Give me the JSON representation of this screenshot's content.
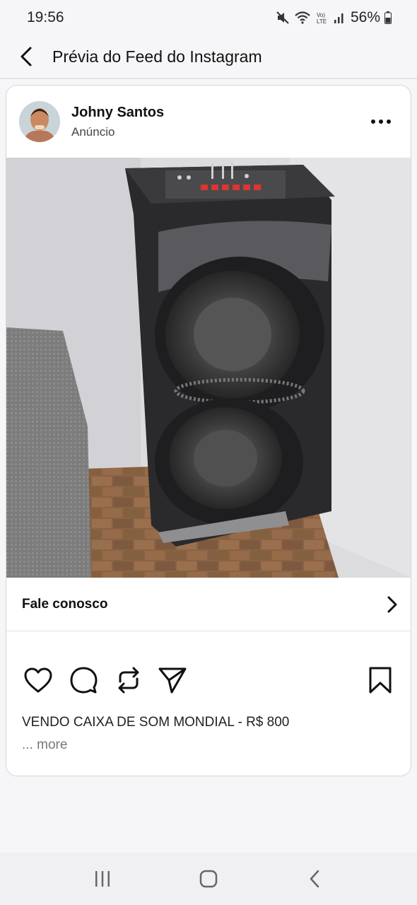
{
  "status_bar": {
    "time": "19:56",
    "battery_percent": "56%",
    "icons": [
      "mute-icon",
      "wifi-icon",
      "volte-icon",
      "signal-icon",
      "battery-icon"
    ]
  },
  "header": {
    "title": "Prévia do Feed do Instagram",
    "back_icon": "chevron-left-icon"
  },
  "post": {
    "author_name": "Johny Santos",
    "author_label": "Anúncio",
    "more_icon": "more-horizontal-icon",
    "image_description": "speaker-photo",
    "cta_label": "Fale conosco",
    "cta_icon": "chevron-right-icon",
    "actions": [
      "heart-icon",
      "comment-icon",
      "repost-icon",
      "share-icon",
      "bookmark-icon"
    ],
    "caption": "VENDO CAIXA DE SOM MONDIAL - R$ 800",
    "more_text": "... more"
  },
  "nav_bar": {
    "buttons": [
      "recent-apps-icon",
      "home-icon",
      "back-icon"
    ]
  }
}
